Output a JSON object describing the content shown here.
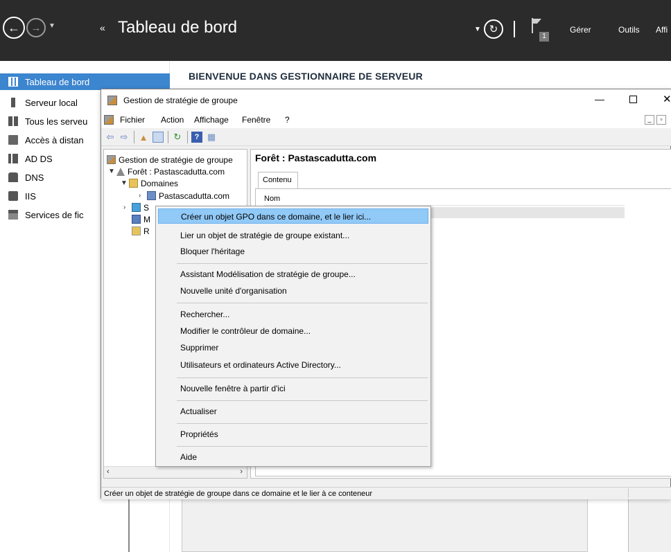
{
  "server_manager": {
    "title": "Tableau de bord",
    "menus": [
      "Gérer",
      "Outils",
      "Affi"
    ],
    "notification_count": "1",
    "welcome": "BIENVENUE DANS GESTIONNAIRE DE SERVEUR",
    "nav": [
      {
        "label": "Tableau de bord",
        "selected": true
      },
      {
        "label": "Serveur local"
      },
      {
        "label": "Tous les serveu"
      },
      {
        "label": "Accès à distan"
      },
      {
        "label": "AD DS"
      },
      {
        "label": "DNS"
      },
      {
        "label": "IIS"
      },
      {
        "label": "Services de fic"
      }
    ]
  },
  "gpmc": {
    "title": "Gestion de stratégie de groupe",
    "menu": [
      "Fichier",
      "Action",
      "Affichage",
      "Fenêtre",
      "?"
    ],
    "tree": {
      "root": "Gestion de stratégie de groupe",
      "forest": "Forêt : Pastascadutta.com",
      "domains": "Domaines",
      "domain": "Pastascadutta.com",
      "item_s": "S",
      "item_m": "M",
      "item_r": "R"
    },
    "right": {
      "header": "Forêt : Pastascadutta.com",
      "tab": "Contenu",
      "column": "Nom"
    },
    "status": "Créer un objet de stratégie de groupe dans ce domaine et le lier à ce conteneur"
  },
  "context_menu": [
    "Créer un objet GPO dans ce domaine, et le lier ici...",
    "Lier un objet de stratégie de groupe existant...",
    "Bloquer l'héritage",
    "Assistant Modélisation de stratégie de groupe...",
    "Nouvelle unité d'organisation",
    "Rechercher...",
    "Modifier le contrôleur de domaine...",
    "Supprimer",
    "Utilisateurs et ordinateurs Active Directory...",
    "Nouvelle fenêtre à partir d'ici",
    "Actualiser",
    "Propriétés",
    "Aide"
  ],
  "colors": {
    "topbar": "#2b2b2b",
    "nav_selected": "#3c85cf",
    "menu_highlight": "#91c9f7"
  }
}
